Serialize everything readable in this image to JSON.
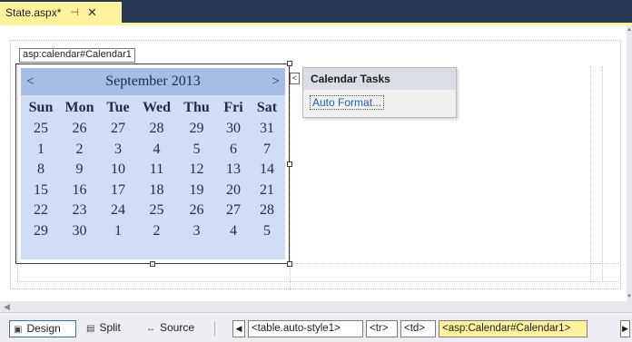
{
  "tab": {
    "title": "State.aspx*",
    "pin_glyph": "⊣",
    "close_glyph": "✕"
  },
  "designer": {
    "control_tag": "asp:calendar#Calendar1"
  },
  "calendar": {
    "prev": "<",
    "next": ">",
    "month_title": "September 2013",
    "day_headers": [
      "Sun",
      "Mon",
      "Tue",
      "Wed",
      "Thu",
      "Fri",
      "Sat"
    ],
    "weeks": [
      [
        "25",
        "26",
        "27",
        "28",
        "29",
        "30",
        "31"
      ],
      [
        "1",
        "2",
        "3",
        "4",
        "5",
        "6",
        "7"
      ],
      [
        "8",
        "9",
        "10",
        "11",
        "12",
        "13",
        "14"
      ],
      [
        "15",
        "16",
        "17",
        "18",
        "19",
        "20",
        "21"
      ],
      [
        "22",
        "23",
        "24",
        "25",
        "26",
        "27",
        "28"
      ],
      [
        "29",
        "30",
        "1",
        "2",
        "3",
        "4",
        "5"
      ]
    ],
    "colors": {
      "header_bg": "#a6bde6",
      "body_bg": "#cfddf7",
      "text": "#1e2c44"
    }
  },
  "smart_tag": {
    "arrow": "<",
    "title": "Calendar Tasks",
    "link": "Auto Format..."
  },
  "statusbar": {
    "views": [
      {
        "label": "Design",
        "icon": "design-view-icon",
        "glyph": "▣"
      },
      {
        "label": "Split",
        "icon": "split-view-icon",
        "glyph": "▤"
      },
      {
        "label": "Source",
        "icon": "source-view-icon",
        "glyph": "↔"
      }
    ],
    "breadcrumbs": [
      "<table.auto-style1>",
      "<tr>",
      "<td>",
      "<asp:Calendar#Calendar1>"
    ],
    "prev_glyph": "◀",
    "next_glyph": "▶"
  },
  "colors": {
    "tab_active": "#fff29d",
    "tab_strip": "#293955",
    "link": "#1a5fb4"
  }
}
